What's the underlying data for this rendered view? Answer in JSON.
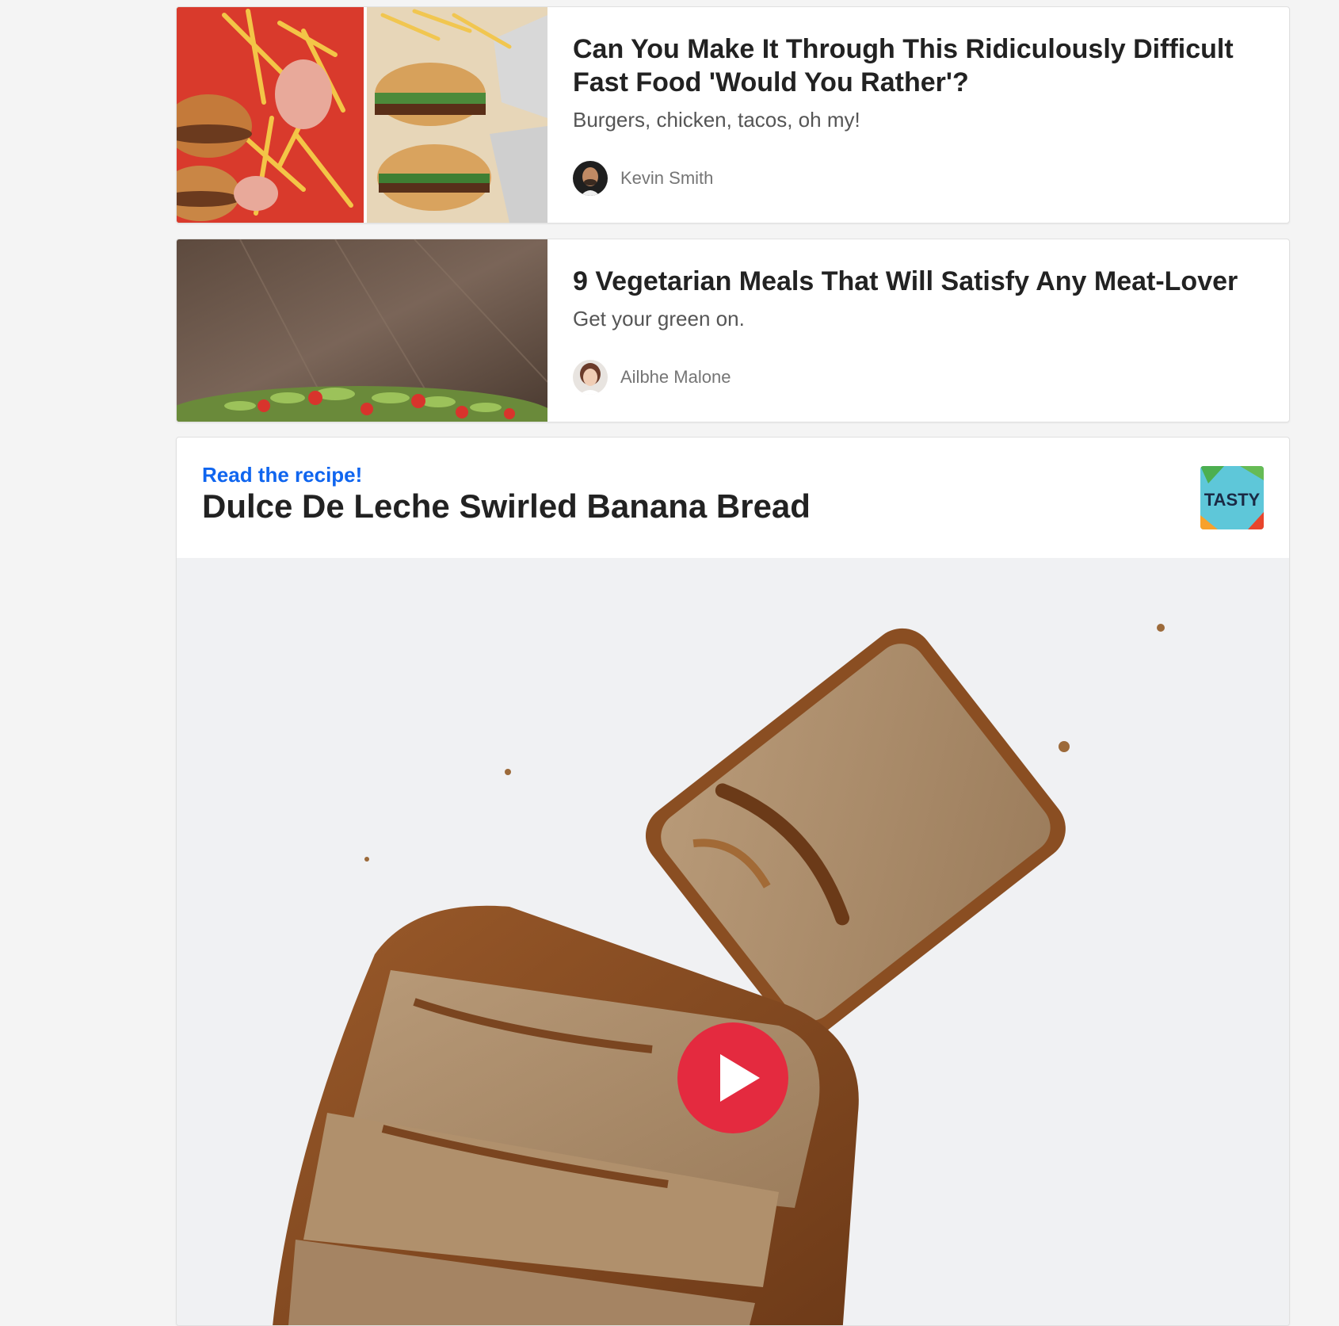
{
  "articles": [
    {
      "title": "Can You Make It Through This Ridiculously Difficult Fast Food 'Would You Rather'?",
      "description": "Burgers, chicken, tacos, oh my!",
      "author": "Kevin Smith",
      "thumbnail": "fast-food-burgers-fries-image",
      "avatar": "kevin-smith-avatar"
    },
    {
      "title": "9 Vegetarian Meals That Will Satisfy Any Meat-Lover",
      "description": "Get your green on.",
      "author": "Ailbhe Malone",
      "thumbnail": "vegetarian-salad-image",
      "avatar": "ailbhe-malone-avatar"
    }
  ],
  "recipe": {
    "kicker": "Read the recipe!",
    "title": "Dulce De Leche Swirled Banana Bread",
    "logo_text": "TASTY",
    "video": "banana-bread-video",
    "play_icon": "play-icon"
  },
  "colors": {
    "kicker": "#0f65ef",
    "play_button": "#e42a3f",
    "page_bg": "#f4f4f4"
  }
}
